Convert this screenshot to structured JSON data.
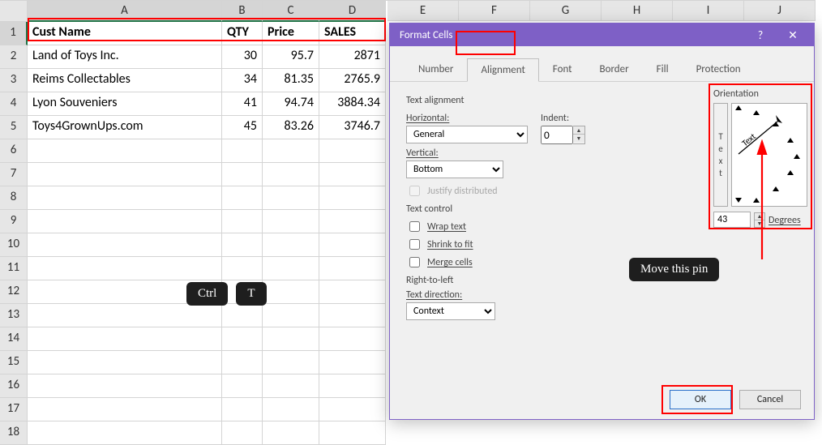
{
  "sheet": {
    "cols_extra": [
      "E",
      "F",
      "G",
      "H",
      "I",
      "J"
    ],
    "col_heads": [
      "A",
      "B",
      "C",
      "D"
    ],
    "headers": {
      "A": "Cust Name",
      "B": "QTY",
      "C": "Price",
      "D": "SALES"
    },
    "rows": [
      {
        "A": "Land of Toys Inc.",
        "B": 30,
        "C": 95.7,
        "D": 2871
      },
      {
        "A": "Reims Collectables",
        "B": 34,
        "C": 81.35,
        "D": 2765.9
      },
      {
        "A": "Lyon Souveniers",
        "B": 41,
        "C": 94.74,
        "D": 3884.34
      },
      {
        "A": "Toys4GrownUps.com",
        "B": 45,
        "C": 83.26,
        "D": 3746.7
      }
    ],
    "blank_row_count": 13
  },
  "keys": {
    "ctrl": "Ctrl",
    "t": "T"
  },
  "dialog": {
    "title": "Format Cells",
    "help": "?",
    "close": "✕",
    "tabs": [
      "Number",
      "Alignment",
      "Font",
      "Border",
      "Fill",
      "Protection"
    ],
    "active_tab": "Alignment",
    "text_alignment_label": "Text alignment",
    "horizontal_label": "Horizontal:",
    "horizontal_value": "General",
    "indent_label": "Indent:",
    "indent_value": "0",
    "vertical_label": "Vertical:",
    "vertical_value": "Bottom",
    "justify_distributed": "Justify distributed",
    "text_control_label": "Text control",
    "wrap_text": "Wrap text",
    "shrink_to_fit": "Shrink to fit",
    "merge_cells": "Merge cells",
    "rtl_label": "Right-to-left",
    "text_direction_label": "Text direction:",
    "text_direction_value": "Context",
    "orientation_label": "Orientation",
    "orientation_vertical_text": "Text",
    "orientation_diag_text": "Text",
    "degrees_value": "43",
    "degrees_label": "Degrees",
    "ok": "OK",
    "cancel": "Cancel",
    "annotation": "Move this pin"
  }
}
